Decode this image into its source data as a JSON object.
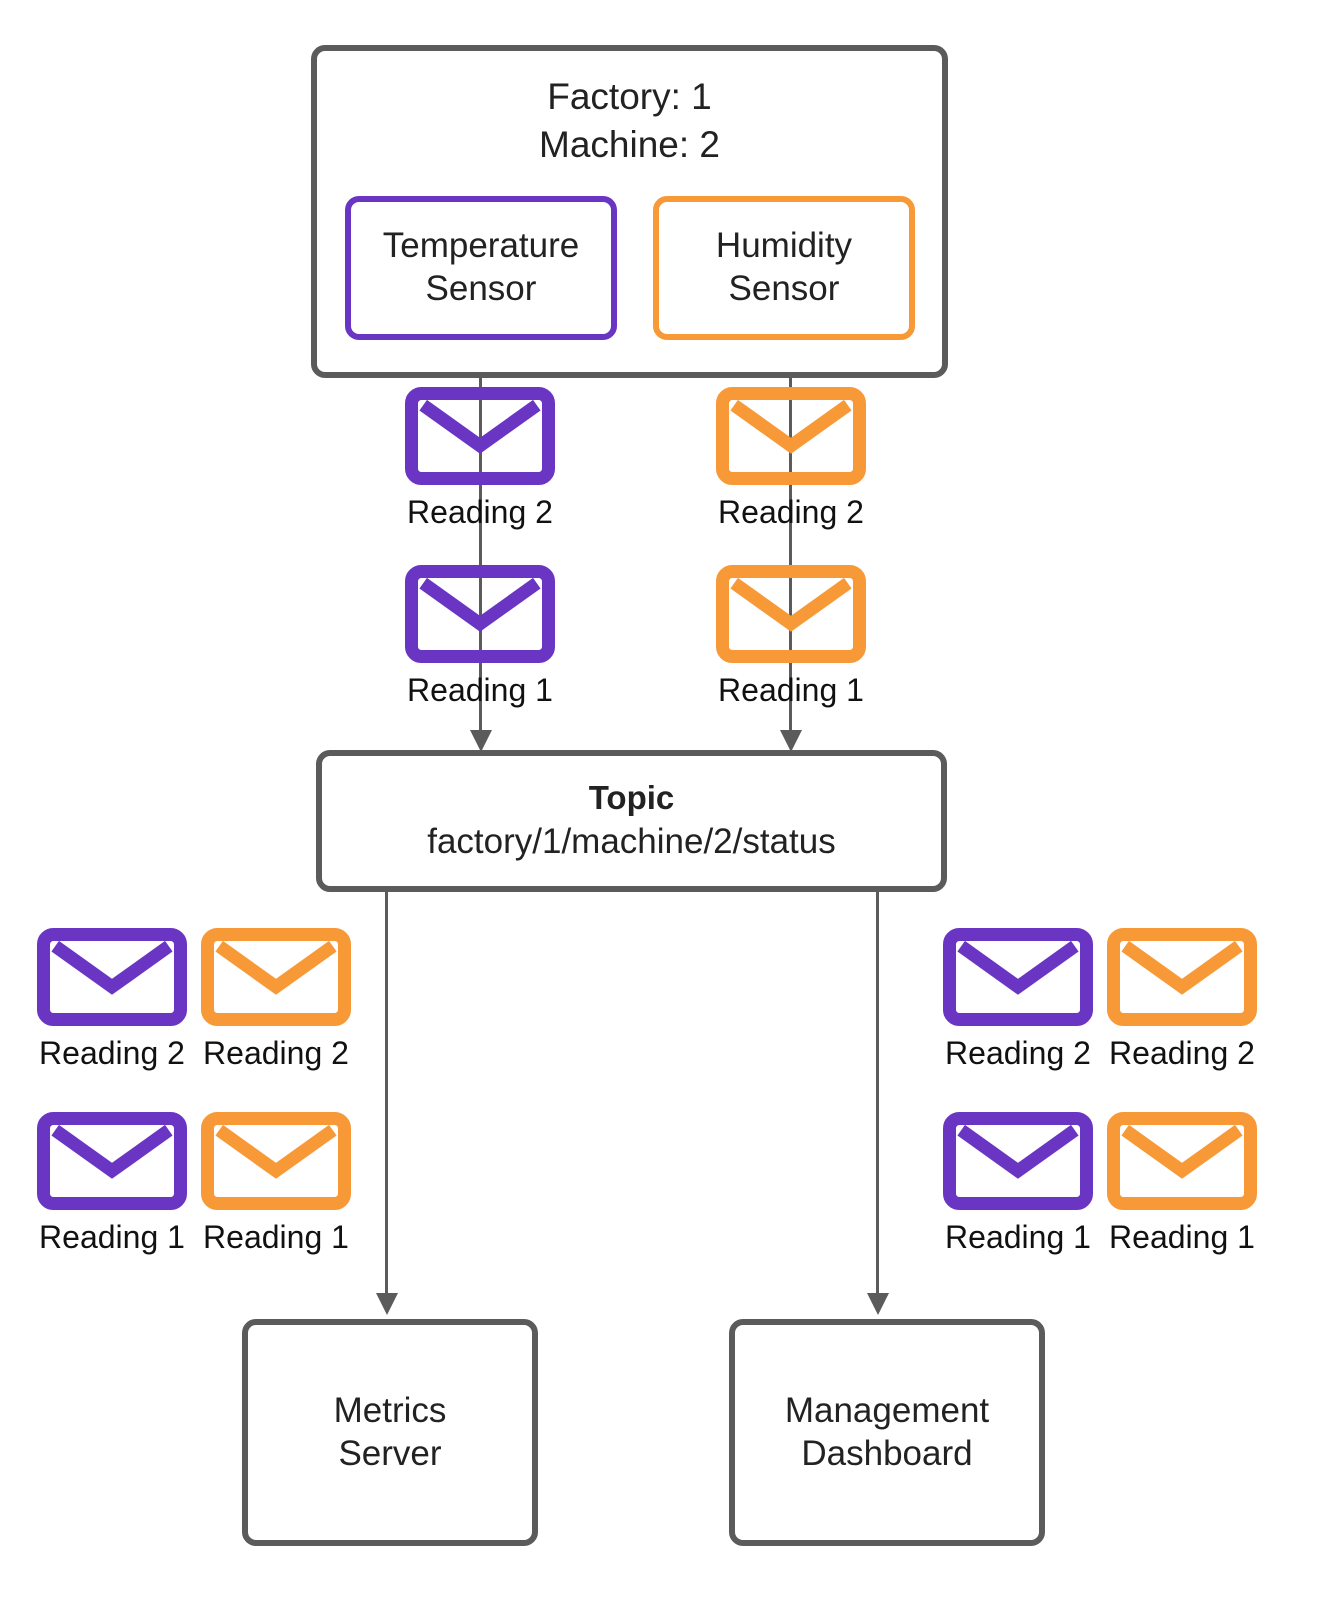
{
  "diagram": {
    "title": "MQTT publish/subscribe topic flow",
    "colors": {
      "purple": "#6a35c3",
      "orange": "#f89938",
      "gray": "#5b5b5b",
      "text": "#1a1a1a",
      "background": "#ffffff"
    }
  },
  "machine": {
    "label": "Factory: 1\nMachine: 2",
    "factory_line": "Factory: 1",
    "machine_line": "Machine: 2"
  },
  "sensors": [
    {
      "id": "temperature",
      "label": "Temperature\nSensor",
      "color": "#6a35c3"
    },
    {
      "id": "humidity",
      "label": "Humidity\nSensor",
      "color": "#f89938"
    }
  ],
  "topic": {
    "title": "Topic",
    "path": "factory/1/machine/2/status"
  },
  "consumers": [
    {
      "id": "metrics-server",
      "label": "Metrics\nServer"
    },
    {
      "id": "management-dashboard",
      "label": "Management\nDashboard"
    }
  ],
  "messages": {
    "publish": {
      "temperature": [
        {
          "label": "Reading 2",
          "color": "#6a35c3",
          "icon": "envelope-icon"
        },
        {
          "label": "Reading 1",
          "color": "#6a35c3",
          "icon": "envelope-icon"
        }
      ],
      "humidity": [
        {
          "label": "Reading 2",
          "color": "#f89938",
          "icon": "envelope-icon"
        },
        {
          "label": "Reading 1",
          "color": "#f89938",
          "icon": "envelope-icon"
        }
      ]
    },
    "deliver_left": [
      {
        "label": "Reading 2",
        "color": "#6a35c3",
        "icon": "envelope-icon"
      },
      {
        "label": "Reading 2",
        "color": "#f89938",
        "icon": "envelope-icon"
      },
      {
        "label": "Reading 1",
        "color": "#6a35c3",
        "icon": "envelope-icon"
      },
      {
        "label": "Reading 1",
        "color": "#f89938",
        "icon": "envelope-icon"
      }
    ],
    "deliver_right": [
      {
        "label": "Reading 2",
        "color": "#6a35c3",
        "icon": "envelope-icon"
      },
      {
        "label": "Reading 2",
        "color": "#f89938",
        "icon": "envelope-icon"
      },
      {
        "label": "Reading 1",
        "color": "#6a35c3",
        "icon": "envelope-icon"
      },
      {
        "label": "Reading 1",
        "color": "#f89938",
        "icon": "envelope-icon"
      }
    ]
  }
}
